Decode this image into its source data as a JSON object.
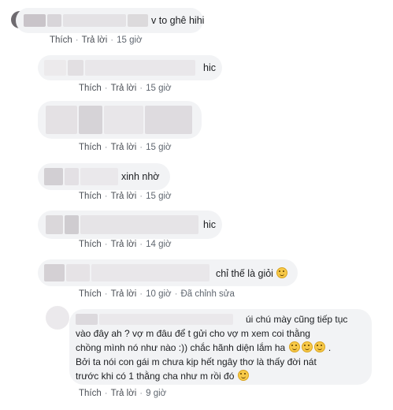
{
  "comments": [
    {
      "text": "to ghê hihi",
      "text_prefix": "v",
      "actions": [
        "Thích",
        "Trả lời",
        "15 giờ"
      ]
    },
    {
      "text": "hic",
      "actions": [
        "Thích",
        "Trả lời",
        "15 giờ"
      ]
    },
    {
      "text": "",
      "actions": [
        "Thích",
        "Trả lời",
        "15 giờ"
      ]
    },
    {
      "text": "xinh nhờ",
      "actions": [
        "Thích",
        "Trả lời",
        "15 giờ"
      ]
    },
    {
      "text": "hic",
      "actions": [
        "Thích",
        "Trả lời",
        "14 giờ"
      ]
    },
    {
      "text": "chỉ thế là giỏi",
      "emoji": "rofl",
      "actions": [
        "Thích",
        "Trả lời",
        "10 giờ",
        "Đã chỉnh sửa"
      ]
    },
    {
      "lines": [
        "úi chú mày cũng tiếp tục",
        "vào đây ah ? vợ m đâu để t gửi cho vợ m xem coi thằng",
        "chồng mình nó như nào :)) chắc hãnh diện lắm ha",
        ".",
        "Bởi ta nói con gái m chưa kịp hết ngây thơ là thấy đời nát",
        "trước khi có 1 thằng cha như m rồi đó"
      ],
      "actions": [
        "Thích",
        "Trả lời",
        "9 giờ"
      ]
    }
  ]
}
